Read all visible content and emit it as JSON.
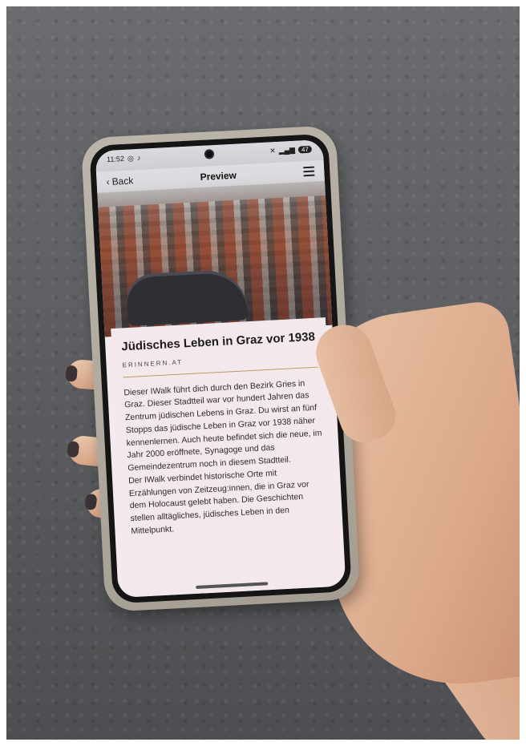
{
  "app": {
    "status_bar": {
      "time": "11:52",
      "battery": "47"
    },
    "nav": {
      "back_label": "Back",
      "title": "Preview"
    },
    "article": {
      "title": "Jüdisches Leben in Graz vor 1938",
      "source": "ERINNERN.AT",
      "paragraph_1": "Dieser IWalk führt dich durch den Bezirk Gries in Graz. Dieser Stadtteil war vor hundert Jahren das Zentrum jüdischen Lebens in Graz. Du wirst an fünf Stopps das jüdische Leben in Graz vor 1938 näher kennenlernen. Auch heute befindet sich die neue, im Jahr 2000 eröffnete, Synagoge und das Gemeindezentrum noch in diesem Stadtteil.",
      "paragraph_2": "Der IWalk verbindet historische Orte mit Erzählungen von Zeitzeug:innen, die in Graz vor dem Holocaust gelebt haben. Die Geschichten stellen alltägliches, jüdisches Leben in den Mittelpunkt."
    }
  },
  "colors": {
    "background_asphalt": "#5a5b5e",
    "phone_case": "#b2aba0",
    "content_background": "#f3e8ec",
    "divider": "#b89a6a"
  }
}
